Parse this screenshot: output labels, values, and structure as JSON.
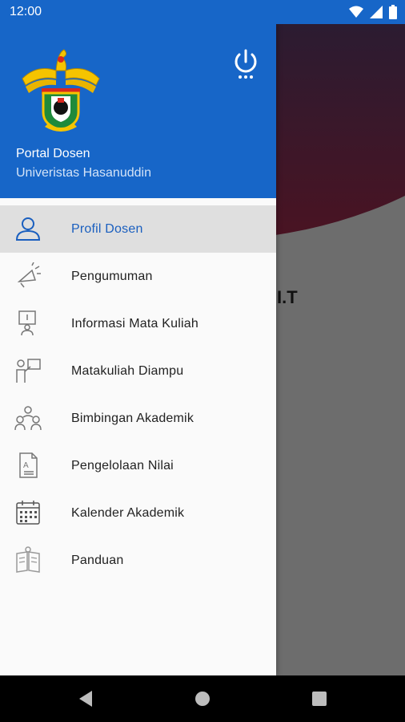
{
  "status_bar": {
    "time": "12:00"
  },
  "background": {
    "partial_text": "I.T"
  },
  "drawer": {
    "title": "Portal Dosen",
    "subtitle": "Univeristas Hasanuddin",
    "menu": [
      {
        "label": "Profil Dosen",
        "icon": "person-icon",
        "active": true
      },
      {
        "label": "Pengumuman",
        "icon": "megaphone-icon"
      },
      {
        "label": "Informasi Mata Kuliah",
        "icon": "presentation-icon"
      },
      {
        "label": "Matakuliah Diampu",
        "icon": "teacher-board-icon"
      },
      {
        "label": "Bimbingan Akademik",
        "icon": "group-icon"
      },
      {
        "label": "Pengelolaan Nilai",
        "icon": "document-grade-icon"
      },
      {
        "label": "Kalender Akademik",
        "icon": "calendar-icon"
      },
      {
        "label": "Panduan",
        "icon": "book-icon"
      }
    ]
  },
  "colors": {
    "primary": "#1766C8",
    "active_text": "#1A5FBF",
    "active_bg": "#DFDFDF"
  }
}
